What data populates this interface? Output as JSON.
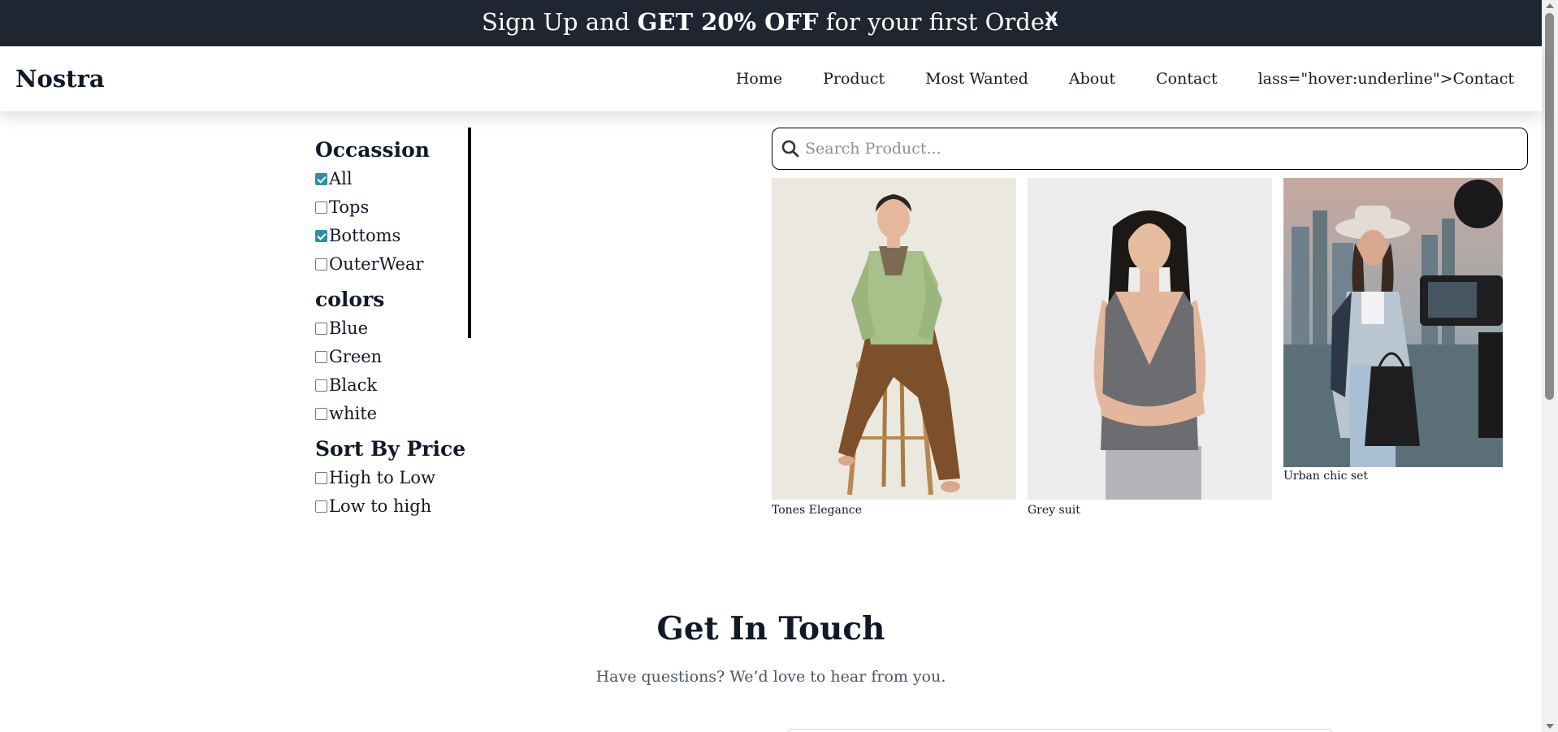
{
  "promo": {
    "text_before": "Sign Up and ",
    "text_bold": "GET 20% OFF",
    "text_after": " for your first Order",
    "close_label": "X"
  },
  "header": {
    "logo": "Nostra",
    "nav": [
      "Home",
      "Product",
      "Most Wanted",
      "About",
      "Contact",
      "lass=\"hover:underline\">Contact"
    ]
  },
  "filters": {
    "occasion": {
      "title": "Occassion",
      "options": [
        {
          "label": "All",
          "checked": true
        },
        {
          "label": "Tops",
          "checked": false
        },
        {
          "label": "Bottoms",
          "checked": true
        },
        {
          "label": "OuterWear",
          "checked": false
        }
      ]
    },
    "colors": {
      "title": "colors",
      "options": [
        {
          "label": "Blue",
          "checked": false
        },
        {
          "label": "Green",
          "checked": false
        },
        {
          "label": "Black",
          "checked": false
        },
        {
          "label": "white",
          "checked": false
        }
      ]
    },
    "sort": {
      "title": "Sort By Price",
      "options": [
        {
          "label": "High to Low",
          "checked": false
        },
        {
          "label": "Low to high",
          "checked": false
        }
      ]
    }
  },
  "search": {
    "placeholder": "Search Product..."
  },
  "products": [
    {
      "name": "Tones Elegance"
    },
    {
      "name": "Grey suit"
    },
    {
      "name": "Urban chic set"
    }
  ],
  "contact": {
    "title": "Get In Touch",
    "subtitle": "Have questions? We’d love to hear from you."
  },
  "colors": {
    "promo_bg": "#1f2632",
    "checkbox_accent": "#2e8fa3"
  }
}
